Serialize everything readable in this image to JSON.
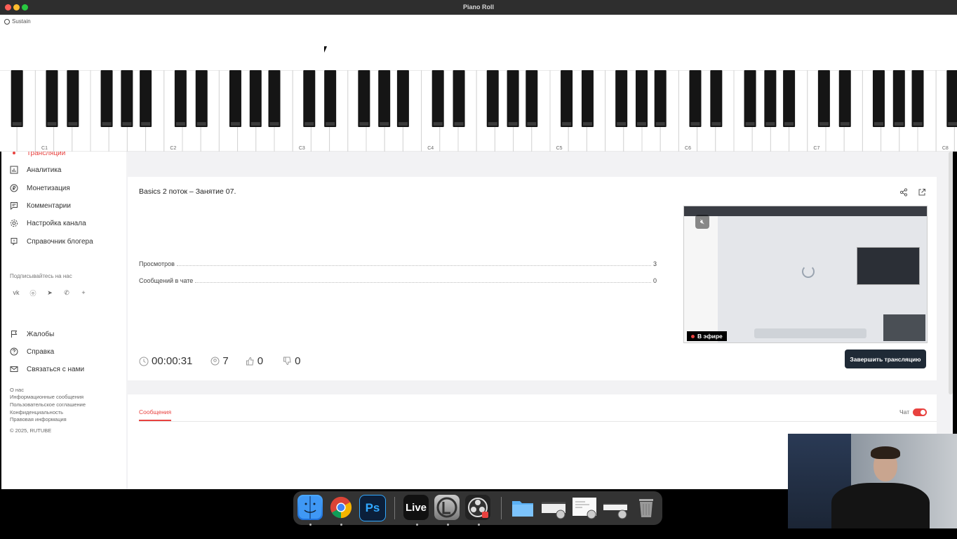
{
  "piano_roll": {
    "title": "Piano Roll",
    "sustain_label": "Sustain",
    "octave_labels": [
      "C1",
      "C2",
      "C3",
      "C4",
      "C5",
      "C6",
      "C7",
      "C8"
    ]
  },
  "sidebar": {
    "partial_item": "Трансляции",
    "items": [
      {
        "label": "Аналитика",
        "icon": "chart-icon"
      },
      {
        "label": "Монетизация",
        "icon": "ruble-icon"
      },
      {
        "label": "Комментарии",
        "icon": "comment-icon"
      },
      {
        "label": "Настройка канала",
        "icon": "gear-icon"
      },
      {
        "label": "Справочник блогера",
        "icon": "info-icon"
      }
    ],
    "subscribe_label": "Подписывайтесь на нас",
    "social_icons": [
      "vk-icon",
      "ok-icon",
      "telegram-icon",
      "viber-icon",
      "plus-icon"
    ],
    "bottom_items": [
      {
        "label": "Жалобы",
        "icon": "flag-icon"
      },
      {
        "label": "Справка",
        "icon": "help-icon"
      },
      {
        "label": "Связаться с нами",
        "icon": "mail-icon"
      }
    ],
    "footer_links": [
      "О нас",
      "Информационные сообщения",
      "Пользовательское соглашение",
      "Конфиденциальность",
      "Правовая информация"
    ],
    "copyright": "© 2025, RUTUBE"
  },
  "stream": {
    "title": "Basics 2 поток – Занятие 07.",
    "stats": [
      {
        "label": "Просмотров",
        "value": "3"
      },
      {
        "label": "Сообщений в чате",
        "value": "0"
      }
    ],
    "duration": "00:00:31",
    "viewers": "7",
    "likes": "0",
    "dislikes": "0",
    "live_badge": "В эфире",
    "end_button": "Завершить трансляцию"
  },
  "chat": {
    "tab_label": "Сообщения",
    "toggle_label": "Чат",
    "toggle_on": true
  },
  "colors": {
    "accent": "#e8423f",
    "dark_button": "#1f2a36"
  },
  "dock": [
    "finder-icon",
    "chrome-icon",
    "photoshop-icon",
    "ableton-live-icon",
    "logic-icon",
    "obs-icon",
    "folder-icon",
    "window-thumb-icon",
    "window-thumb-icon",
    "window-thumb-icon",
    "trash-icon"
  ],
  "dock_labels": {
    "photoshop": "Ps",
    "live": "Live"
  }
}
